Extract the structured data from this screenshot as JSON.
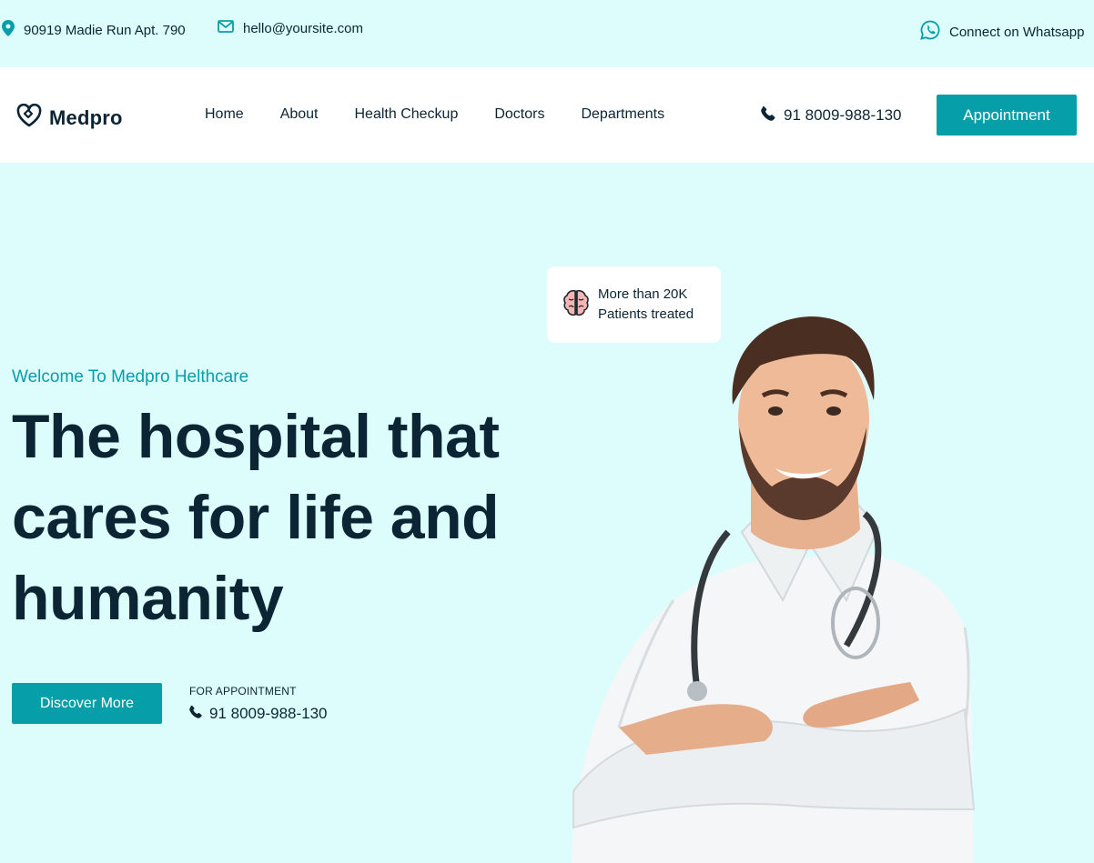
{
  "topbar": {
    "address": "90919 Madie Run Apt. 790",
    "email": "hello@yoursite.com",
    "whatsapp": "Connect on Whatsapp",
    "icons": [
      "map-pin-icon",
      "mail-icon",
      "whatsapp-icon"
    ]
  },
  "nav": {
    "logo_text": "Medpro",
    "links": [
      "Home",
      "About",
      "Health Checkup",
      "Doctors",
      "Departments"
    ],
    "phone": "91 8009-988-130",
    "appointment_label": "Appointment"
  },
  "hero": {
    "subtitle": "Welcome To Medpro Helthcare",
    "title_line1": "The hospital that",
    "title_line2": "cares for life and",
    "title_line3": "humanity",
    "discover_label": "Discover More",
    "for_appointment_label": "FOR APPOINTMENT",
    "phone": "91 8009-988-130"
  },
  "stat_card": {
    "line1": "More than 20K",
    "line2": "Patients treated",
    "icon": "brain-icon"
  },
  "colors": {
    "accent": "#069ea8",
    "background": "#dcfdfb",
    "text_dark": "#0b2534"
  }
}
